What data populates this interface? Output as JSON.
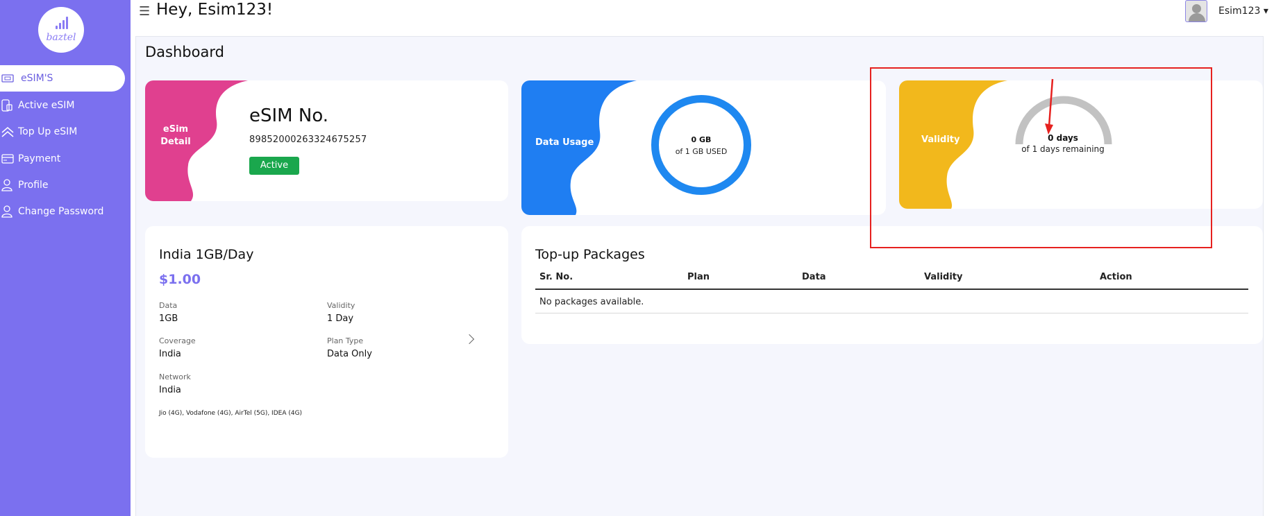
{
  "logo": {
    "text": "baztel"
  },
  "sidebar": {
    "items": [
      {
        "label": "eSIM'S",
        "icon": "sim-card-icon",
        "active": true
      },
      {
        "label": "Active eSIM",
        "icon": "phone-sim-icon",
        "active": false
      },
      {
        "label": "Top Up eSIM",
        "icon": "double-chevron-up-icon",
        "active": false
      },
      {
        "label": "Payment",
        "icon": "credit-card-icon",
        "active": false
      },
      {
        "label": "Profile",
        "icon": "user-icon",
        "active": false
      },
      {
        "label": "Change Password",
        "icon": "user-lock-icon",
        "active": false
      }
    ]
  },
  "header": {
    "menu_icon": "☰",
    "greeting": "Hey, Esim123!",
    "user_name": "Esim123 ▾"
  },
  "page": {
    "title": "Dashboard"
  },
  "esim_card": {
    "tab_label_line1": "eSim",
    "tab_label_line2": "Detail",
    "number_label": "eSIM No.",
    "number_value": "89852000263324675257",
    "status": "Active"
  },
  "usage_card": {
    "tab_label": "Data Usage",
    "value": "0 GB",
    "subtext": "of 1 GB USED",
    "used_fraction": 0
  },
  "validity_card": {
    "tab_label": "Validity",
    "value": "0 days",
    "subtext": "of 1 days remaining",
    "remaining_fraction": 0
  },
  "plan_card": {
    "name": "India 1GB/Day",
    "price": "$1.00",
    "fields": {
      "data_label": "Data",
      "data_value": "1GB",
      "validity_label": "Validity",
      "validity_value": "1 Day",
      "coverage_label": "Coverage",
      "coverage_value": "India",
      "plan_type_label": "Plan Type",
      "plan_type_value": "Data Only",
      "network_label": "Network",
      "network_value": "India"
    },
    "operators": "Jio (4G), Vodafone (4G), AirTel (5G), IDEA (4G)"
  },
  "topup_card": {
    "title": "Top-up Packages",
    "columns": [
      "Sr. No.",
      "Plan",
      "Data",
      "Validity",
      "Action"
    ],
    "empty_message": "No packages available."
  },
  "colors": {
    "sidebar": "#7b70ef",
    "accent": "#7b70ef",
    "esim_blob": "#e0408f",
    "usage_blob": "#1f7ef2",
    "validity_blob": "#f2b81c",
    "status_active": "#1aa74d",
    "annotation": "#e6211f"
  }
}
